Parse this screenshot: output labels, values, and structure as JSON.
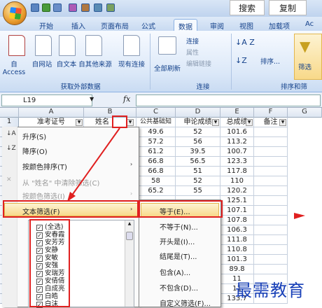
{
  "titlebar": {
    "search_label": "搜索",
    "copy_label": "复制"
  },
  "tabs": [
    "开始",
    "插入",
    "页面布局",
    "公式",
    "数据",
    "审阅",
    "视图",
    "加载项",
    "Ac"
  ],
  "ribbon": {
    "get_external": [
      "自 Access",
      "自网站",
      "自文本",
      "自其他来源",
      "现有连接"
    ],
    "get_external_label": "获取外部数据",
    "refresh_all": "全部刷新",
    "conn_items": [
      "连接",
      "属性",
      "编辑链接"
    ],
    "conn_label": "连接",
    "sort_label": "排序...",
    "filter_label": "筛选",
    "sort_group_label": "排序和筛"
  },
  "formula_bar": {
    "cell_ref": "L19",
    "fx": "fx"
  },
  "columns": [
    "A",
    "B",
    "C",
    "D",
    "E",
    "F",
    "G"
  ],
  "header_row": {
    "num": "1",
    "cells": [
      "准考证号",
      "姓名",
      "公共基础知",
      "申论成绩",
      "总成绩",
      "备注"
    ]
  },
  "rows": [
    {
      "num": "",
      "c": "49.6",
      "d": "52",
      "e": "101.6"
    },
    {
      "num": "",
      "c": "57.2",
      "d": "56",
      "e": "113.2"
    },
    {
      "num": "",
      "c": "61.2",
      "d": "39.5",
      "e": "100.7"
    },
    {
      "num": "",
      "c": "66.8",
      "d": "56.5",
      "e": "123.3"
    },
    {
      "num": "",
      "c": "66.8",
      "d": "51",
      "e": "117.8"
    },
    {
      "num": "",
      "c": "58",
      "d": "52",
      "e": "110"
    },
    {
      "num": "",
      "c": "65.2",
      "d": "55",
      "e": "120.2"
    },
    {
      "num": "",
      "c": "",
      "d": "",
      "e": "125.1"
    },
    {
      "num": "",
      "c": "",
      "d": "",
      "e": "107.1"
    },
    {
      "num": "",
      "c": "",
      "d": "",
      "e": "107.8"
    },
    {
      "num": "",
      "c": "",
      "d": "",
      "e": "106.3"
    },
    {
      "num": "",
      "c": "",
      "d": "",
      "e": "111.8"
    },
    {
      "num": "",
      "c": "",
      "d": "",
      "e": "110.8"
    },
    {
      "num": "",
      "c": "",
      "d": "",
      "e": "101.3"
    },
    {
      "num": "",
      "c": "",
      "d": "",
      "e": "89.8"
    },
    {
      "num": "",
      "c": "",
      "d": "",
      "e": "11"
    },
    {
      "num": "",
      "c": "",
      "d": "",
      "e": "11"
    },
    {
      "num": "",
      "c": "",
      "d": "",
      "e": "133.7"
    }
  ],
  "menu": {
    "sort_asc": "升序(S)",
    "sort_desc": "降序(O)",
    "sort_color": "按颜色排序(T)",
    "clear_filter": "从 \"姓名\" 中清除筛选(C)",
    "filter_color": "按颜色筛选(I)",
    "text_filter": "文本筛选(F)"
  },
  "submenu": [
    "等于(E)...",
    "不等于(N)...",
    "开头是(I)...",
    "结尾是(T)...",
    "包含(A)...",
    "不包含(D)...",
    "自定义筛选(F)..."
  ],
  "checklist": [
    "(全选)",
    "安春霞",
    "安芳芳",
    "安静",
    "安敏",
    "安强",
    "安瑞芳",
    "安倩倩",
    "白成亮",
    "白皓",
    "白沫"
  ],
  "watermark": "最需教育",
  "colors": {
    "annotation": "#e02020",
    "highlight": "#f8d98a"
  }
}
